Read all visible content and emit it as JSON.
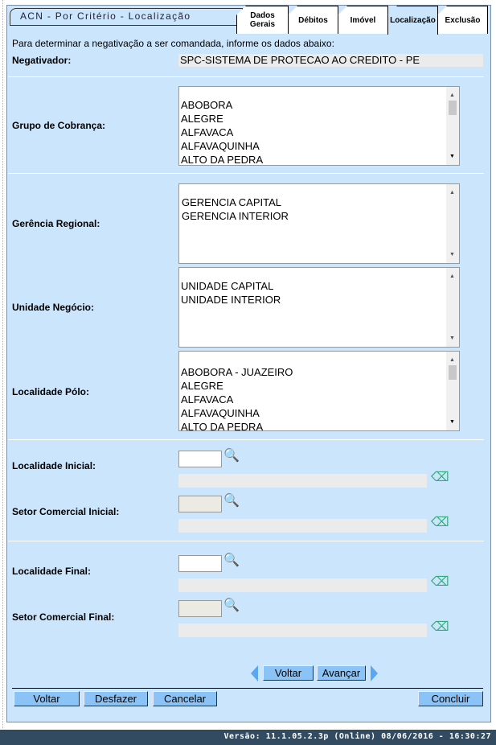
{
  "title": "ACN - Por Critério - Localização",
  "tabs": [
    {
      "label": "Dados Gerais"
    },
    {
      "label": "Débitos"
    },
    {
      "label": "Imóvel"
    },
    {
      "label": "Localização",
      "active": true
    },
    {
      "label": "Exclusão"
    }
  ],
  "intro": "Para determinar a negativação a ser comandada, informe os dados abaixo:",
  "negativador": {
    "label": "Negativador:",
    "value": "SPC-SISTEMA DE PROTECAO AO CREDITO - PE"
  },
  "grupo": {
    "label": "Grupo de Cobrança:",
    "options": [
      "ABOBORA",
      "ALEGRE",
      "ALFAVACA",
      "ALFAVAQUINHA",
      "ALTO DA PEDRA"
    ]
  },
  "gerencia": {
    "label": "Gerência Regional:",
    "options": [
      "GERENCIA CAPITAL",
      "GERENCIA INTERIOR"
    ]
  },
  "unidade": {
    "label": "Unidade Negócio:",
    "options": [
      "UNIDADE CAPITAL",
      "UNIDADE INTERIOR"
    ]
  },
  "localidade_polo": {
    "label": "Localidade Pólo:",
    "options": [
      "ABOBORA - JUAZEIRO",
      "ALEGRE",
      "ALFAVACA",
      "ALFAVAQUINHA",
      "ALTO DA PEDRA"
    ]
  },
  "fields": [
    {
      "label": "Localidade Inicial:",
      "value": ""
    },
    {
      "label": "Setor Comercial Inicial:",
      "value": ""
    },
    {
      "label": "Localidade Final:",
      "value": ""
    },
    {
      "label": "Setor Comercial Final:",
      "value": ""
    }
  ],
  "nav": {
    "back": "Voltar",
    "next": "Avançar"
  },
  "buttons": {
    "voltar": "Voltar",
    "desfazer": "Desfazer",
    "cancelar": "Cancelar",
    "concluir": "Concluir"
  },
  "footer": "Versão: 11.1.05.2.3p (Online) 08/06/2016 - 16:30:27",
  "colors": {
    "panel": "#cbe5fd",
    "button": "#8cc3f6",
    "footer": "#334b60"
  }
}
